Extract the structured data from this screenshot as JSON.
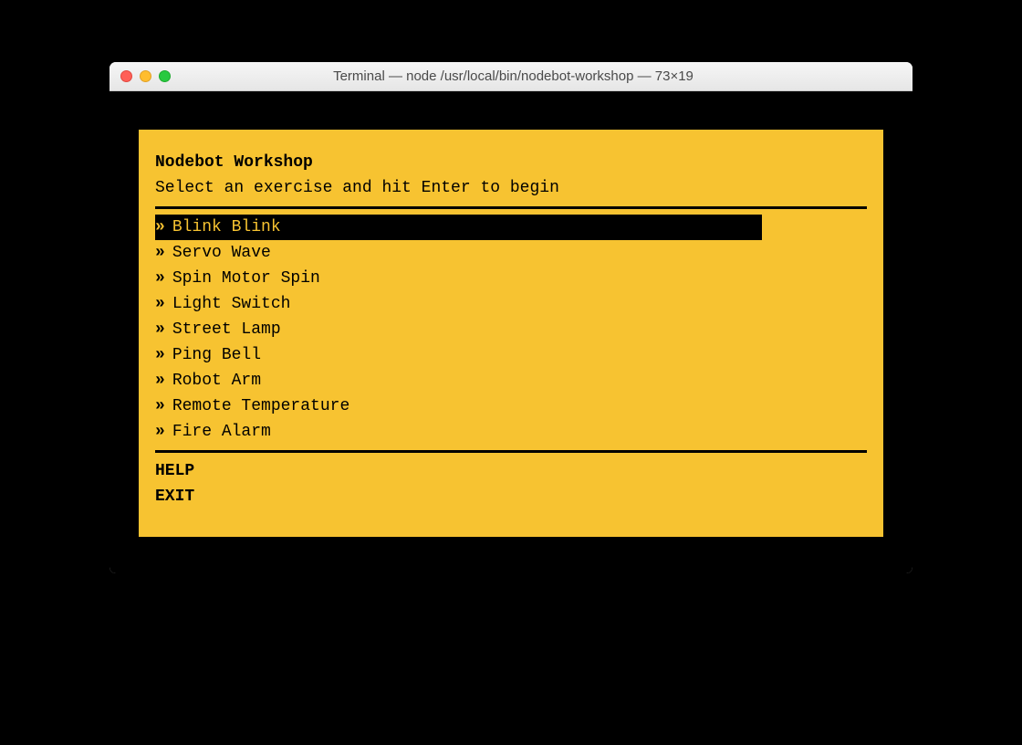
{
  "window": {
    "title": "Terminal — node /usr/local/bin/nodebot-workshop — 73×19"
  },
  "app": {
    "heading": "Nodebot Workshop",
    "subtitle": "Select an exercise and hit Enter to begin",
    "menu": {
      "bullet": "»",
      "selected_index": 0,
      "items": [
        {
          "label": "Blink Blink"
        },
        {
          "label": "Servo Wave"
        },
        {
          "label": "Spin Motor Spin"
        },
        {
          "label": "Light Switch"
        },
        {
          "label": "Street Lamp"
        },
        {
          "label": "Ping Bell"
        },
        {
          "label": "Robot Arm"
        },
        {
          "label": "Remote Temperature"
        },
        {
          "label": "Fire Alarm"
        }
      ]
    },
    "footer": {
      "help": "HELP",
      "exit": "EXIT"
    }
  },
  "colors": {
    "terminal_bg": "#000000",
    "screen_bg": "#f7c331",
    "text": "#000000",
    "selected_bg": "#000000",
    "selected_fg": "#f7c331"
  }
}
